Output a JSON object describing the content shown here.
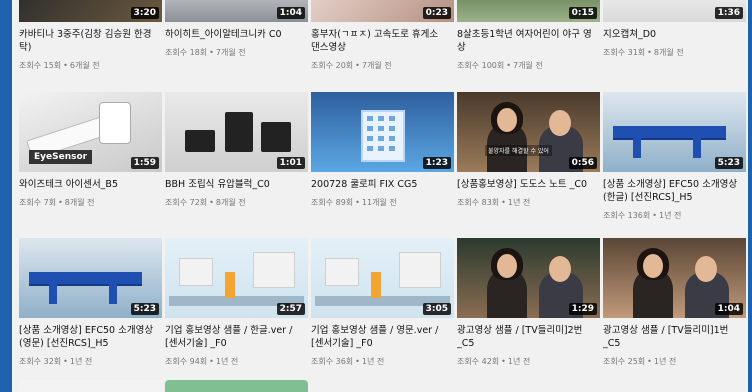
{
  "videos": [
    {
      "title": "카바티나 3중주(김창 김승원 한경탁)",
      "views": "조회수 15회",
      "age": "6개월 전",
      "duration": "3:20",
      "thumb": "t-dark"
    },
    {
      "title": "하이히트_아이알테크니카 C0",
      "views": "조회수 18회",
      "age": "7개월 전",
      "duration": "1:04",
      "thumb": "t-gray"
    },
    {
      "title": "홍부자(ㄱㅍㅈ) 고속도로 휴게소 댄스영상",
      "views": "조회수 20회",
      "age": "7개월 전",
      "duration": "0:23",
      "thumb": "t-pink"
    },
    {
      "title": "8살초등1학년 여자어린이 야구 영상",
      "views": "조회수 100회",
      "age": "7개월 전",
      "duration": "0:15",
      "thumb": "t-green"
    },
    {
      "title": "지오캡쳐_D0",
      "views": "조회수 31회",
      "age": "8개월 전",
      "duration": "1:36",
      "thumb": "t-white"
    },
    {
      "title": "와이즈테크 아이센서_B5",
      "views": "조회수 7회",
      "age": "8개월 전",
      "duration": "1:59",
      "thumb": "t-sensor",
      "logo": "EyeSensor"
    },
    {
      "title": "BBH 조립식 유압블럭_C0",
      "views": "조회수 72회",
      "age": "8개월 전",
      "duration": "1:01",
      "thumb": "t-blocks"
    },
    {
      "title": "200728 쿨로피 FIX CG5",
      "views": "조회수 89회",
      "age": "11개월 전",
      "duration": "1:23",
      "thumb": "t-lab"
    },
    {
      "title": "[상품홍보영상] 도도스 노트 _C0",
      "views": "조회수 83회",
      "age": "1년 전",
      "duration": "0:56",
      "thumb": "t-ms",
      "subtitle": "불양자를 해결할 수 있어"
    },
    {
      "title": "[상품 소개영상] EFC50 소개영상(한글) [선진RCS]_H5",
      "views": "조회수 136회",
      "age": "1년 전",
      "duration": "5:23",
      "thumb": "t-rail"
    },
    {
      "title": "[상품 소개영상] EFC50 소개영상(영문) [선진RCS]_H5",
      "views": "조회수 32회",
      "age": "1년 전",
      "duration": "5:23",
      "thumb": "t-rail"
    },
    {
      "title": "기업 홍보영상 샘플 / 한글.ver / [센서기술] _F0",
      "views": "조회수 94회",
      "age": "1년 전",
      "duration": "2:57",
      "thumb": "t-iso"
    },
    {
      "title": "기업 홍보영상 샘플 / 영문.ver / [센서기술] _F0",
      "views": "조회수 36회",
      "age": "1년 전",
      "duration": "3:05",
      "thumb": "t-iso"
    },
    {
      "title": "광고영상 샘플 / [TV들리미]2번_C5",
      "views": "조회수 42회",
      "age": "1년 전",
      "duration": "1:29",
      "thumb": "t-cpl"
    },
    {
      "title": "광고영상 샘플 / [TV들리미]1번_C5",
      "views": "조회수 25회",
      "age": "1년 전",
      "duration": "1:04",
      "thumb": "t-cpl2"
    }
  ],
  "separator": "•"
}
